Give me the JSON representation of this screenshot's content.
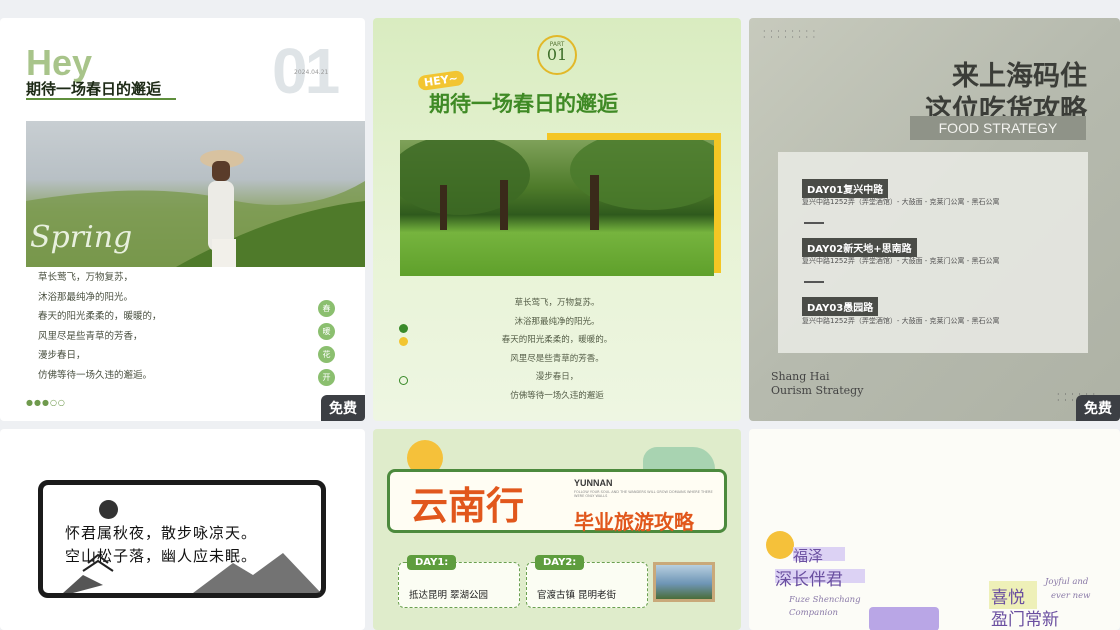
{
  "badge_label": "免费",
  "card1": {
    "hey": "Hey",
    "title": "期待一场春日的邂逅",
    "big_number": "01",
    "date": "2024.04.21",
    "script_word": "Spring",
    "poem": [
      "草长莺飞，万物复苏，",
      "沐浴那最纯净的阳光。",
      "春天的阳光柔柔的，暖暖的，",
      "风里尽是些青草的芳香，",
      "漫步春日，",
      "仿佛等待一场久违的邂逅。"
    ],
    "dots": [
      "春",
      "暖",
      "花",
      "开"
    ],
    "pager": "●●●○○"
  },
  "card2": {
    "part_label": "PART",
    "part_number": "01",
    "hey": "HEY~",
    "title": "期待一场春日的邂逅",
    "poem": [
      "草长莺飞，万物复苏。",
      "沐浴那最纯净的阳光。",
      "春天的阳光柔柔的，暖暖的。",
      "风里尽是些青草的芳香。",
      "漫步春日，",
      "仿佛等待一场久违的邂逅"
    ]
  },
  "card3": {
    "title_line1": "来上海码住",
    "title_line2": "这位吃货攻略",
    "subtitle": "FOOD STRATEGY",
    "days": [
      {
        "label": "DAY01复兴中路",
        "detail": "复兴中路1252弄（弄堂酒馆）- 大鼓面 - 克莱门公寓 - 黑石公寓"
      },
      {
        "label": "DAY02新天地+思南路",
        "detail": "复兴中路1252弄（弄堂酒馆）- 大鼓面 - 克莱门公寓 - 黑石公寓"
      },
      {
        "label": "DAY03愚园路",
        "detail": "复兴中路1252弄（弄堂酒馆）- 大鼓面 - 克莱门公寓 - 黑石公寓"
      }
    ],
    "footer_line1": "Shang Hai",
    "footer_line2": "Ourism Strategy"
  },
  "card4": {
    "line1": "怀君属秋夜，散步咏凉天。",
    "line2": "空山松子落，幽人应未眠。"
  },
  "card5": {
    "big_title": "云南行",
    "yunnan": "YUNNAN",
    "small_text": "FOLLOW YOUR SOUL AND THE WANDERS WILL GROW DOMAINS WHERE THERE WERE ONLY WALLS",
    "subtitle": "毕业旅游攻略",
    "day1_tag": "DAY1:",
    "day1_text": "抵达昆明 翠湖公园",
    "day2_tag": "DAY2:",
    "day2_text": "官渡古镇 昆明老街"
  },
  "card6": {
    "text1": "福泽",
    "text2": "深长伴君",
    "script1": "Fuze Shenchang",
    "script2": "Companion",
    "text3": "喜悦",
    "text4": "盈门常新",
    "script3": "Joyful and",
    "script4": "ever new"
  }
}
